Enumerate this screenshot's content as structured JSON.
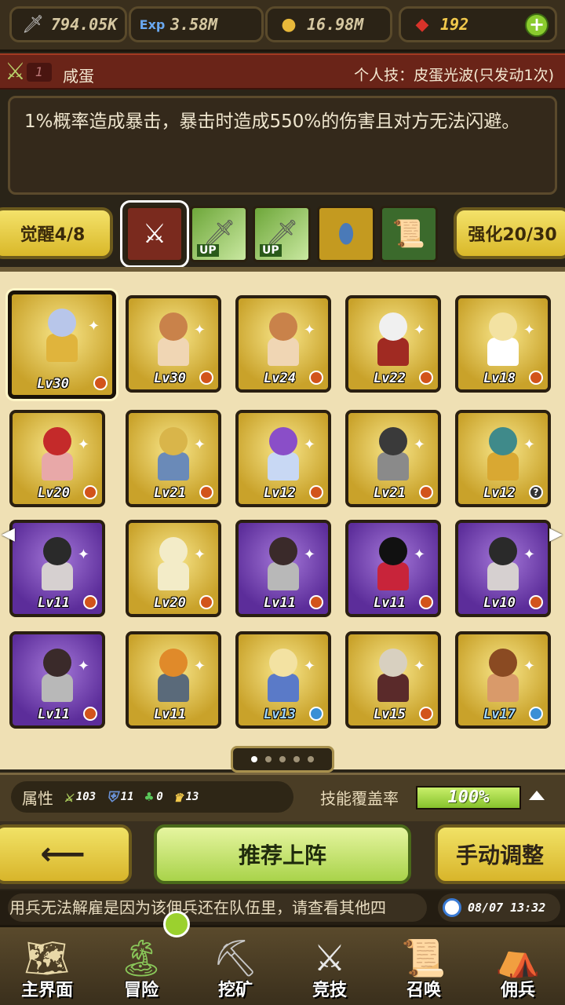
{
  "resources": {
    "attack": {
      "icon": "sword-icon",
      "value": "794.05K"
    },
    "exp": {
      "icon": "exp-icon",
      "value": "3.58M"
    },
    "gold": {
      "icon": "coin-icon",
      "value": "16.98M"
    },
    "gems": {
      "icon": "ruby-icon",
      "value": "192"
    }
  },
  "skill": {
    "index": "1",
    "hero_name": "咸蛋",
    "personal_skill": "个人技：皮蛋光波(只发动1次)",
    "description": "1%概率造成暴击，暴击时造成550%的伤害且对方无法闪避。"
  },
  "awaken": {
    "label": "觉醒4/8"
  },
  "strengthen": {
    "label": "强化20/30"
  },
  "equipment_slots": [
    {
      "icon": "broken-sword-icon",
      "badge": ""
    },
    {
      "icon": "sword-upgrade-icon",
      "badge": "UP"
    },
    {
      "icon": "sword-upgrade-icon",
      "badge": "UP"
    },
    {
      "icon": "egg-icon",
      "badge": ""
    },
    {
      "icon": "scroll-icon",
      "badge": ""
    }
  ],
  "heroes": [
    {
      "level": "Lv30",
      "frame": "gold",
      "badge": "orange",
      "head": "#b8c6ea",
      "body": "#e0b43c"
    },
    {
      "level": "Lv30",
      "frame": "gold",
      "badge": "orange",
      "head": "#c9824a",
      "body": "#f0d6b4"
    },
    {
      "level": "Lv24",
      "frame": "gold",
      "badge": "orange",
      "head": "#c9824a",
      "body": "#f0d6b4"
    },
    {
      "level": "Lv22",
      "frame": "gold",
      "badge": "orange",
      "head": "#f0f0f0",
      "body": "#a02a22"
    },
    {
      "level": "Lv18",
      "frame": "gold",
      "badge": "orange",
      "head": "#f3e2a2",
      "body": "#ffffff"
    },
    {
      "level": "Lv20",
      "frame": "gold",
      "badge": "orange",
      "head": "#c42a2a",
      "body": "#e8a8a8"
    },
    {
      "level": "Lv21",
      "frame": "gold",
      "badge": "orange",
      "head": "#d9b54a",
      "body": "#6a8ab8"
    },
    {
      "level": "Lv12",
      "frame": "gold",
      "badge": "orange",
      "head": "#8a4ec8",
      "body": "#c8d8f4"
    },
    {
      "level": "Lv21",
      "frame": "gold",
      "badge": "orange",
      "head": "#3a3a3a",
      "body": "#8a8a8a"
    },
    {
      "level": "Lv12",
      "frame": "gold",
      "badge": "question",
      "head": "#3f8a8a",
      "body": "#d9a832"
    },
    {
      "level": "Lv11",
      "frame": "purple",
      "badge": "orange",
      "head": "#2a2a2a",
      "body": "#d6d0d0"
    },
    {
      "level": "Lv20",
      "frame": "gold",
      "badge": "orange",
      "head": "#f3ecc8",
      "body": "#f3ecc8"
    },
    {
      "level": "Lv11",
      "frame": "purple",
      "badge": "orange",
      "head": "#3a2a2a",
      "body": "#b8b8b8"
    },
    {
      "level": "Lv11",
      "frame": "purple",
      "badge": "orange",
      "head": "#111111",
      "body": "#c8243a"
    },
    {
      "level": "Lv10",
      "frame": "purple",
      "badge": "orange",
      "head": "#2a2a2a",
      "body": "#d6d0d0"
    },
    {
      "level": "Lv11",
      "frame": "purple",
      "badge": "orange",
      "head": "#3a2a2a",
      "body": "#b8b8b8"
    },
    {
      "level": "Lv11",
      "frame": "gold",
      "badge": "none",
      "head": "#e08a2a",
      "body": "#5a6a7a"
    },
    {
      "level": "Lv13",
      "frame": "gold",
      "badge": "blue",
      "head": "#f3e2a2",
      "body": "#5a7ac8"
    },
    {
      "level": "Lv15",
      "frame": "gold",
      "badge": "orange",
      "head": "#d8d0c0",
      "body": "#5a2a2a"
    },
    {
      "level": "Lv17",
      "frame": "gold",
      "badge": "blue",
      "head": "#8a4a22",
      "body": "#d99a6a"
    }
  ],
  "pager": {
    "pages": 5,
    "current": 0
  },
  "stats": {
    "label": "属性",
    "items": [
      {
        "icon": "sword-stat-icon",
        "value": "103"
      },
      {
        "icon": "shield-stat-icon",
        "value": "11"
      },
      {
        "icon": "heal-stat-icon",
        "value": "0"
      },
      {
        "icon": "crown-stat-icon",
        "value": "13"
      }
    ],
    "coverage_label": "技能覆盖率",
    "coverage_value": "100%",
    "coverage_fraction": 1.0
  },
  "actions": {
    "back": "⟵",
    "recommend": "推荐上阵",
    "manual": "手动调整"
  },
  "ticker": {
    "message": "用兵无法解雇是因为该佣兵还在队伍里，请查看其他四",
    "time": "08/07 13:32"
  },
  "nav": [
    {
      "label": "主界面",
      "icon": "map-icon"
    },
    {
      "label": "冒险",
      "icon": "island-icon"
    },
    {
      "label": "挖矿",
      "icon": "pickaxe-icon"
    },
    {
      "label": "竞技",
      "icon": "crossed-swords-icon"
    },
    {
      "label": "召唤",
      "icon": "summon-scroll-icon"
    },
    {
      "label": "佣兵",
      "icon": "tent-icon"
    }
  ]
}
